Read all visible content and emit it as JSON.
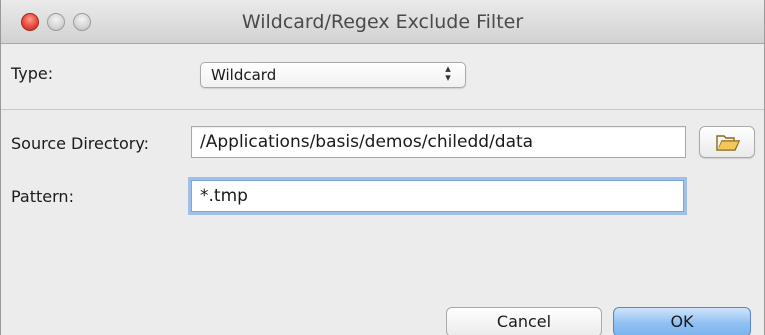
{
  "window": {
    "title": "Wildcard/Regex Exclude Filter"
  },
  "type_row": {
    "label": "Type:",
    "selected": "Wildcard",
    "arrows": "⬍"
  },
  "source_row": {
    "label": "Source Directory:",
    "value": "/Applications/basis/demos/chiledd/data",
    "browse_icon": "folder-open-icon"
  },
  "pattern_row": {
    "label": "Pattern:",
    "value": "*.tmp"
  },
  "buttons": {
    "cancel": "Cancel",
    "ok": "OK"
  },
  "colors": {
    "close_light": "#e9483b",
    "default_button": "#8fc0f2",
    "focus_ring": "#9fc1e9"
  }
}
